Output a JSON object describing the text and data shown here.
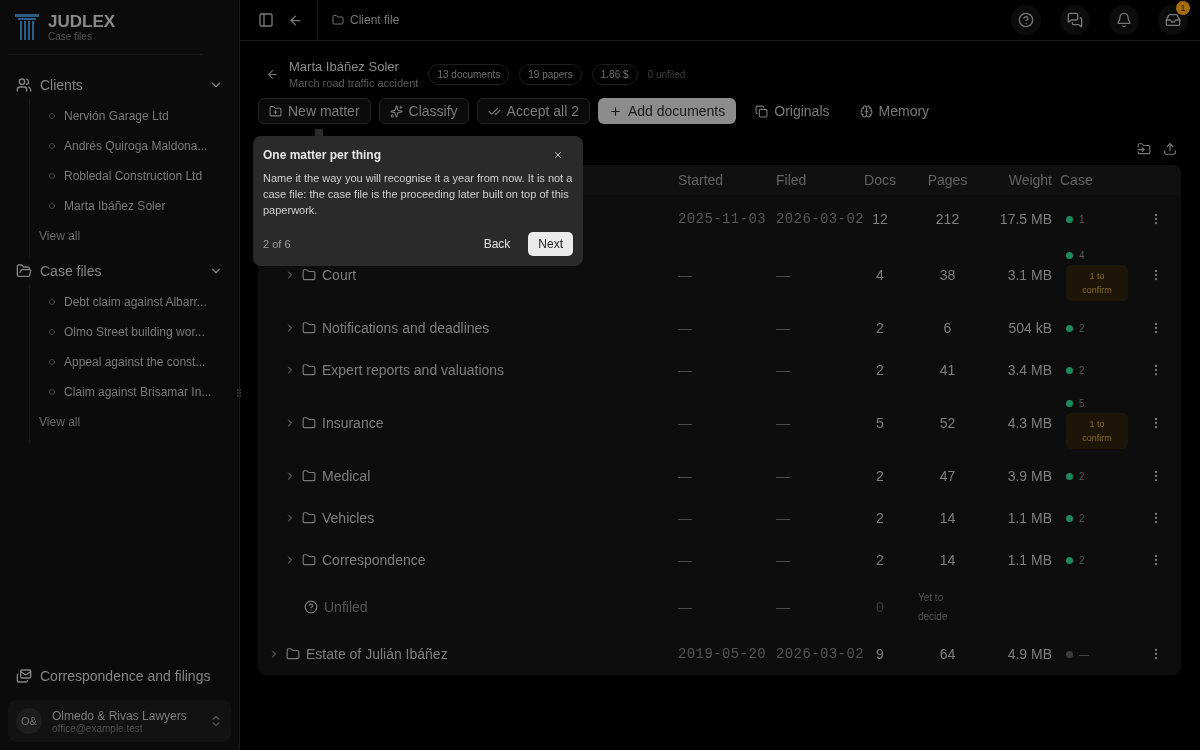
{
  "sidebar": {
    "logo": {
      "name": "JUDLEX",
      "subtitle": "Case files"
    },
    "sections": [
      {
        "title": "Clients",
        "expanded": true,
        "items": [
          "Nervión Garage Ltd",
          "Andrés Quiroga Maldona...",
          "Robledal Construction Ltd",
          "Marta Ibáñez Soler"
        ],
        "view_all": "View all"
      },
      {
        "title": "Case files",
        "expanded": true,
        "items": [
          "Debt claim against Albarr...",
          "Olmo Street building wor...",
          "Appeal against the const...",
          "Claim against Brisamar In..."
        ],
        "view_all": "View all"
      }
    ],
    "footer_link": "Correspondence and filings",
    "account": {
      "initials": "O&",
      "name": "Olmedo & Rivas Lawyers",
      "email": "office@example.test"
    }
  },
  "topbar": {
    "breadcrumb": "Client file",
    "notifications_badge": "1"
  },
  "header": {
    "title": "Marta Ibáñez Soler",
    "subtitle": "March road traffic accident",
    "chips": [
      "13 documents",
      "19 papers",
      "1.86 $"
    ],
    "unfiled": "0 unfiled"
  },
  "toolbar": [
    {
      "kind": "outline",
      "label": "New matter"
    },
    {
      "kind": "outline",
      "label": "Classify"
    },
    {
      "kind": "outline",
      "label": "Accept all 2"
    },
    {
      "kind": "highlighted",
      "label": "Add documents"
    },
    {
      "kind": "ghost",
      "label": "Originals"
    },
    {
      "kind": "ghost",
      "label": "Memory"
    }
  ],
  "tour": {
    "title": "One matter per thing",
    "body": "Name it the way you will recognise it a year from now. It is not a case file: the case file is the proceeding later built on top of this paperwork.",
    "step": "2 of 6",
    "buttons": [
      {
        "kind": "ghost",
        "label": "Back"
      },
      {
        "kind": "solid",
        "label": "Next"
      }
    ]
  },
  "table": {
    "columns": [
      "Started",
      "Filed",
      "Docs",
      "Pages",
      "Weight",
      "Case"
    ],
    "rows": [
      {
        "kind": "matter",
        "started": "2025-11-03",
        "filed": "2026-03-02",
        "docs": "12",
        "pages": "212",
        "weight": "17.5 MB",
        "case": {
          "color": "#1c8a5a",
          "count": "1"
        },
        "children": [
          {
            "kind": "folder",
            "name": "Court",
            "started": "—",
            "filed": "—",
            "docs": "4",
            "pages": "38",
            "weight": "3.1 MB",
            "case": {
              "color": "#1c8a5a",
              "count": "4",
              "confirm": "1 to confirm"
            }
          },
          {
            "kind": "folder",
            "name": "Notifications and deadlines",
            "started": "—",
            "filed": "—",
            "docs": "2",
            "pages": "6",
            "weight": "504 kB",
            "case": {
              "color": "#1c8a5a",
              "count": "2"
            }
          },
          {
            "kind": "folder",
            "name": "Expert reports and valuations",
            "started": "—",
            "filed": "—",
            "docs": "2",
            "pages": "41",
            "weight": "3.4 MB",
            "case": {
              "color": "#1c8a5a",
              "count": "2"
            }
          },
          {
            "kind": "folder",
            "name": "Insurance",
            "started": "—",
            "filed": "—",
            "docs": "5",
            "pages": "52",
            "weight": "4.3 MB",
            "case": {
              "color": "#1c8a5a",
              "count": "5",
              "confirm": "1 to confirm"
            }
          },
          {
            "kind": "folder",
            "name": "Medical",
            "started": "—",
            "filed": "—",
            "docs": "2",
            "pages": "47",
            "weight": "3.9 MB",
            "case": {
              "color": "#1c8a5a",
              "count": "2"
            }
          },
          {
            "kind": "folder",
            "name": "Vehicles",
            "started": "—",
            "filed": "—",
            "docs": "2",
            "pages": "14",
            "weight": "1.1 MB",
            "case": {
              "color": "#1c8a5a",
              "count": "2"
            }
          },
          {
            "kind": "folder",
            "name": "Correspondence",
            "started": "—",
            "filed": "—",
            "docs": "2",
            "pages": "14",
            "weight": "1.1 MB",
            "case": {
              "color": "#1c8a5a",
              "count": "2"
            }
          },
          {
            "kind": "unfiled",
            "name": "Unfiled",
            "started": "—",
            "filed": "—",
            "docs": "0",
            "pages": "Yet to decide"
          }
        ]
      },
      {
        "kind": "matter",
        "name": "Estate of Julián Ibáñez",
        "started": "2019-05-20",
        "filed": "2026-03-02",
        "docs": "9",
        "pages": "64",
        "weight": "4.9 MB",
        "case": {
          "color": "#3a3a3a",
          "count": "—"
        }
      }
    ]
  }
}
